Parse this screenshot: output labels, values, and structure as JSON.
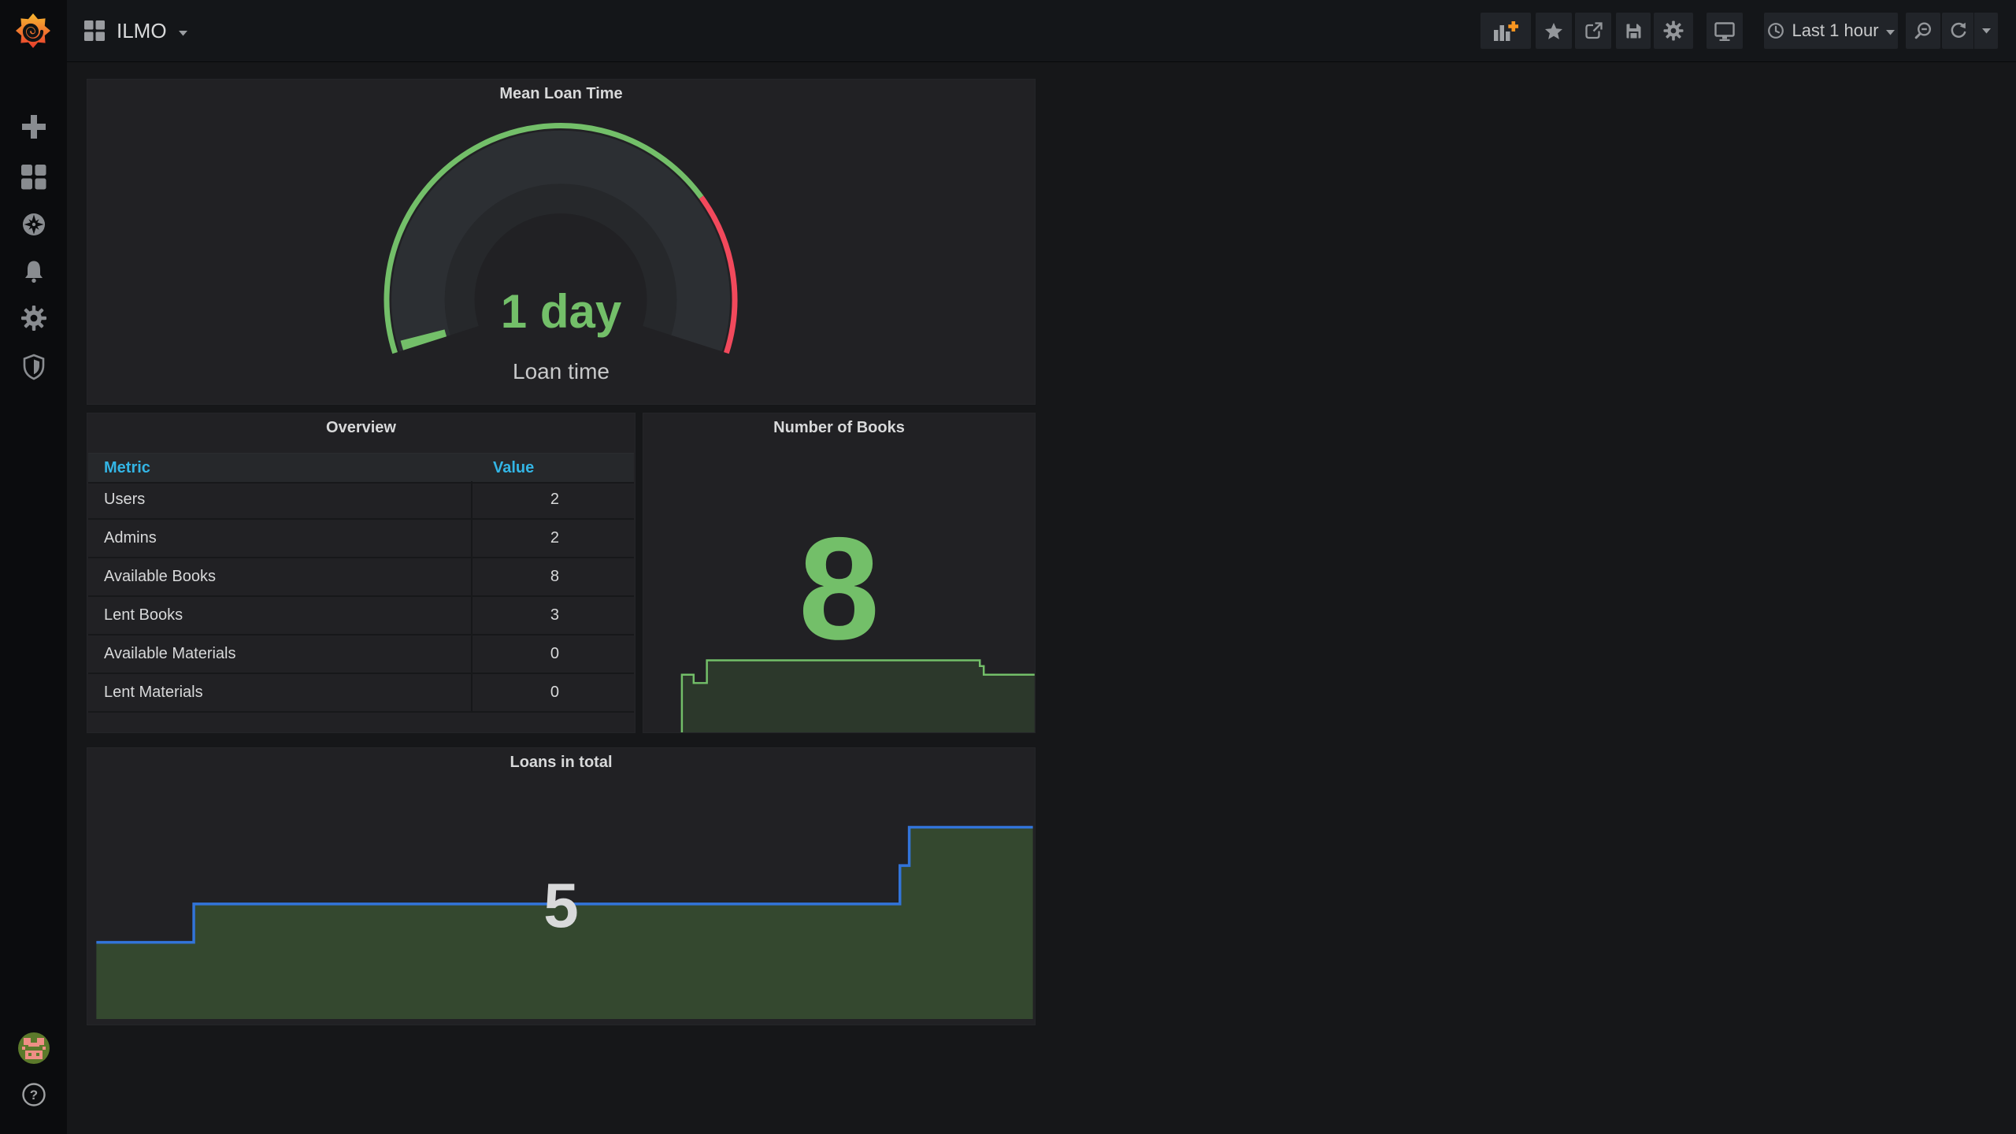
{
  "topbar": {
    "title": "ILMO",
    "time_range": "Last 1 hour",
    "icon_names": [
      "add-panel-icon",
      "star-icon",
      "share-icon",
      "save-icon",
      "settings-gear-icon",
      "tv-mode-icon",
      "clock-icon",
      "zoom-out-icon",
      "refresh-icon",
      "refresh-interval-caret-icon"
    ]
  },
  "sidebar": {
    "icon_names": [
      "grafana-logo",
      "create-plus-icon",
      "dashboards-grid-icon",
      "explore-compass-icon",
      "alerting-bell-icon",
      "configuration-gear-icon",
      "server-admin-shield-icon",
      "user-avatar",
      "help-icon"
    ]
  },
  "panels": {
    "mean_loan_time": {
      "title": "Mean Loan Time",
      "value": "1 day",
      "label": "Loan time"
    },
    "overview": {
      "title": "Overview",
      "columns": [
        "Metric",
        "Value"
      ],
      "rows": [
        {
          "metric": "Users",
          "value": "2"
        },
        {
          "metric": "Admins",
          "value": "2"
        },
        {
          "metric": "Available Books",
          "value": "8"
        },
        {
          "metric": "Lent Books",
          "value": "3"
        },
        {
          "metric": "Available Materials",
          "value": "0"
        },
        {
          "metric": "Lent Materials",
          "value": "0"
        }
      ]
    },
    "number_of_books": {
      "title": "Number of Books",
      "value": "8"
    },
    "loans_in_total": {
      "title": "Loans in total",
      "value": "5"
    }
  },
  "colors": {
    "page_bg": "#161719",
    "panel_bg": "#212124",
    "sidebar_bg": "#0b0c0e",
    "green": "#73bf69",
    "red": "#f2495c",
    "blue_line": "#3274d9",
    "table_header_blue": "#33b5e5",
    "text": "#d8d9da",
    "accent_orange": "#f79520"
  },
  "chart_data": {
    "mean_loan_time_gauge": {
      "type": "gauge",
      "value_text": "1 day",
      "label": "Loan time",
      "value_fraction": 0.016,
      "threshold_green_fraction": 0.75,
      "green": "#73bf69",
      "red": "#f2495c"
    },
    "number_of_books_spark": {
      "type": "area",
      "note": "sparkline under stat 8, x = fraction of time range, y normalized 0-1 of spark height",
      "line_color": "#73bf69",
      "fill_color": "#2c382b",
      "points": [
        [
          0.098,
          0
        ],
        [
          0.098,
          0.8
        ],
        [
          0.128,
          0.8
        ],
        [
          0.128,
          0.685
        ],
        [
          0.162,
          0.685
        ],
        [
          0.162,
          1
        ],
        [
          0.86,
          1
        ],
        [
          0.86,
          0.92
        ],
        [
          0.87,
          0.92
        ],
        [
          0.87,
          0.8
        ],
        [
          1,
          0.8
        ]
      ]
    },
    "loans_total_spark": {
      "type": "area",
      "note": "step area, x = fraction of time range, y = loans count",
      "line_color": "#3274d9",
      "fill_color": "#34482f",
      "points": [
        [
          0,
          2
        ],
        [
          0.104,
          2
        ],
        [
          0.104,
          3
        ],
        [
          0.858,
          3
        ],
        [
          0.858,
          4
        ],
        [
          0.868,
          4
        ],
        [
          0.868,
          5
        ],
        [
          1,
          5
        ]
      ]
    }
  }
}
